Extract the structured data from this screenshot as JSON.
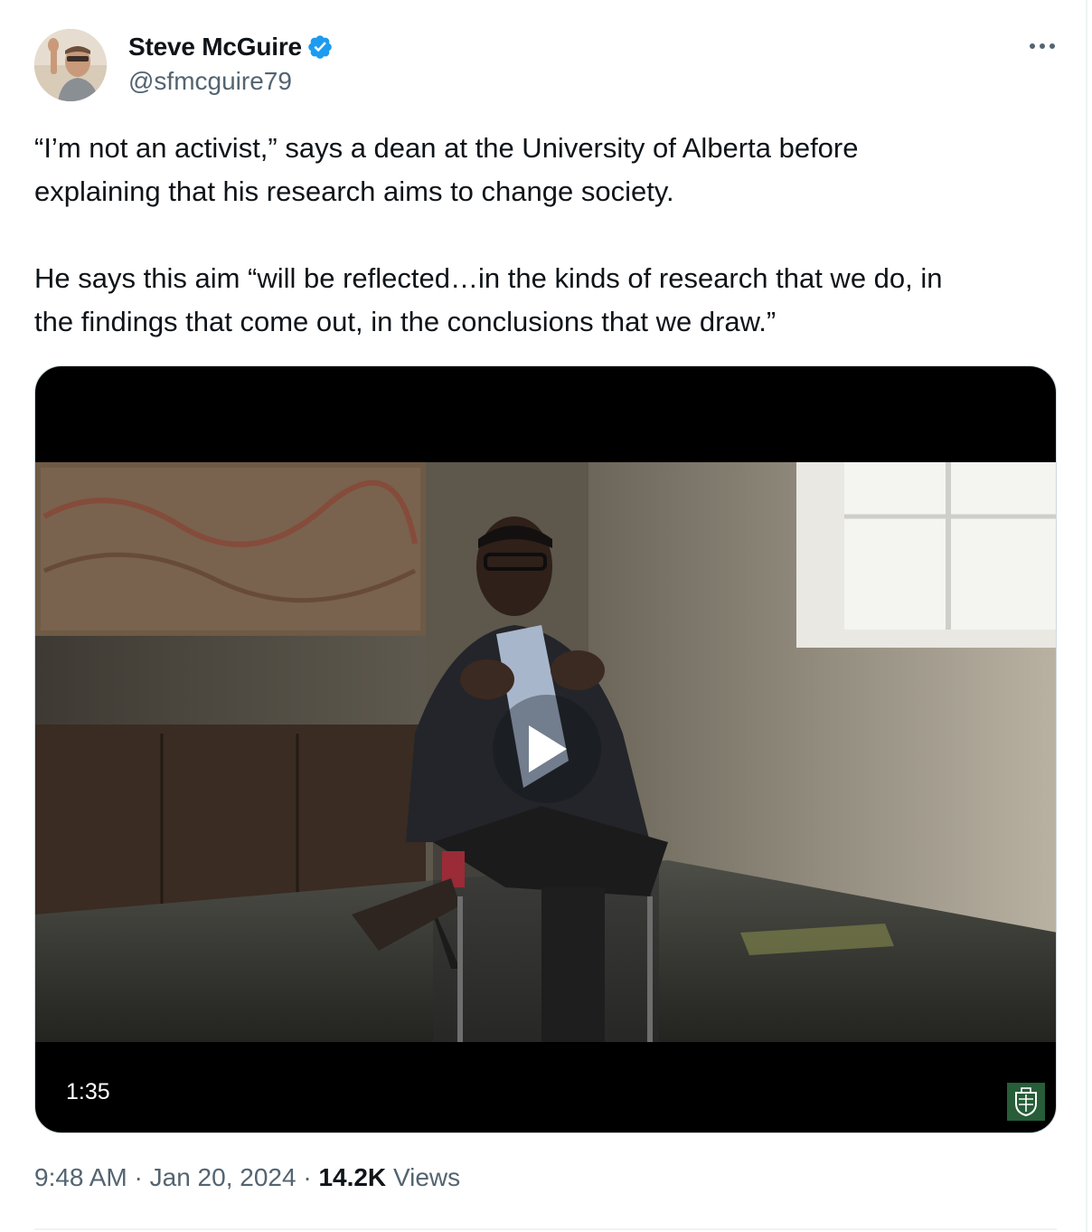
{
  "author": {
    "display_name": "Steve McGuire",
    "handle": "@sfmcguire79",
    "verified": true,
    "avatar_icon": "profile-photo"
  },
  "menu": {
    "icon": "more-horizontal-icon"
  },
  "tweet": {
    "paragraph1_line1": "“I’m not an activist,” says a dean at the University of Alberta before",
    "paragraph1_line2": "explaining that his research aims to change society.",
    "paragraph2_line1": "He says this aim “will be reflected…in the kinds of research that we do, in",
    "paragraph2_line2": "the findings that come out, in the conclusions that we draw.”"
  },
  "video": {
    "duration": "1:35",
    "play_icon": "play-icon",
    "watermark_icon": "university-of-alberta-logo"
  },
  "meta": {
    "time": "9:48 AM",
    "separator": "·",
    "date": "Jan 20, 2024",
    "views_count": "14.2K",
    "views_label": "Views"
  },
  "colors": {
    "text_primary": "#0f1419",
    "text_secondary": "#536471",
    "verified_blue": "#1d9bf0",
    "border": "#cfd9de",
    "uofa_green": "#275d38"
  }
}
